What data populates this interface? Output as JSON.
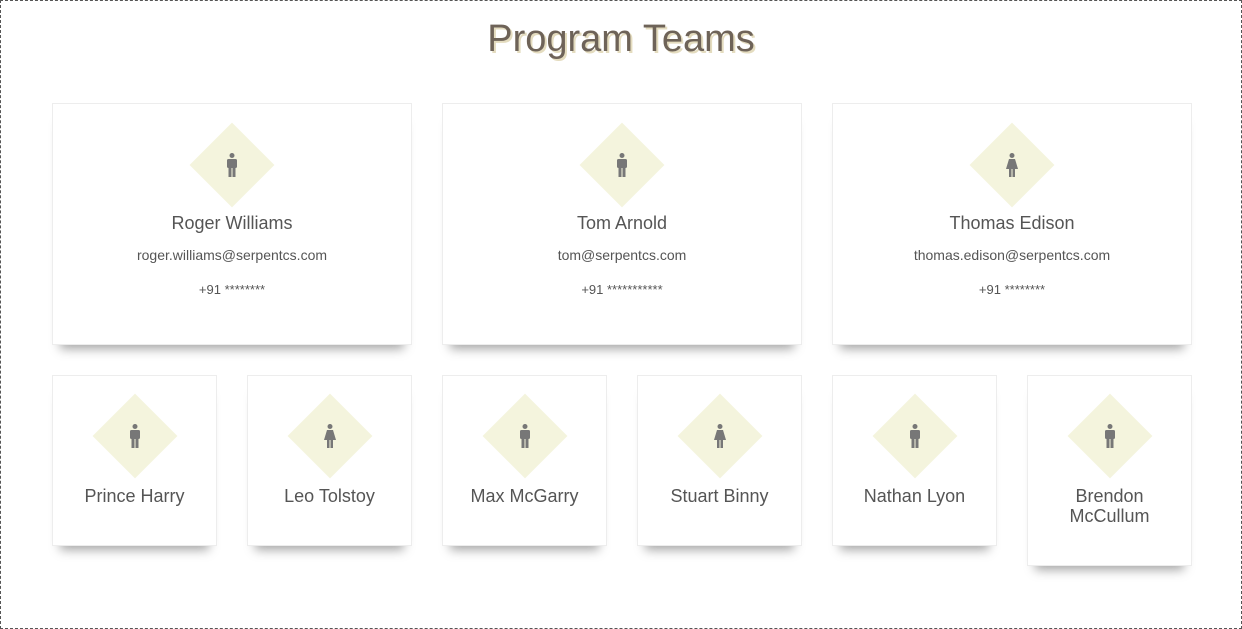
{
  "title": "Program Teams",
  "leaders": [
    {
      "name": "Roger Williams",
      "email": "roger.williams@serpentcs.com",
      "phone": "+91 ********",
      "icon": "male-icon"
    },
    {
      "name": "Tom Arnold",
      "email": "tom@serpentcs.com",
      "phone": "+91 ***********",
      "icon": "male-icon"
    },
    {
      "name": "Thomas Edison",
      "email": "thomas.edison@serpentcs.com",
      "phone": "+91 ********",
      "icon": "female-icon"
    }
  ],
  "members": [
    {
      "name": "Prince Harry",
      "icon": "male-icon"
    },
    {
      "name": "Leo Tolstoy",
      "icon": "female-icon"
    },
    {
      "name": "Max McGarry",
      "icon": "male-icon"
    },
    {
      "name": "Stuart Binny",
      "icon": "female-icon"
    },
    {
      "name": "Nathan Lyon",
      "icon": "male-icon"
    },
    {
      "name": "Brendon McCullum",
      "icon": "male-icon"
    }
  ],
  "colors": {
    "avatar_bg": "#f4f4dd",
    "icon": "#777777",
    "title": "#6e6358"
  }
}
